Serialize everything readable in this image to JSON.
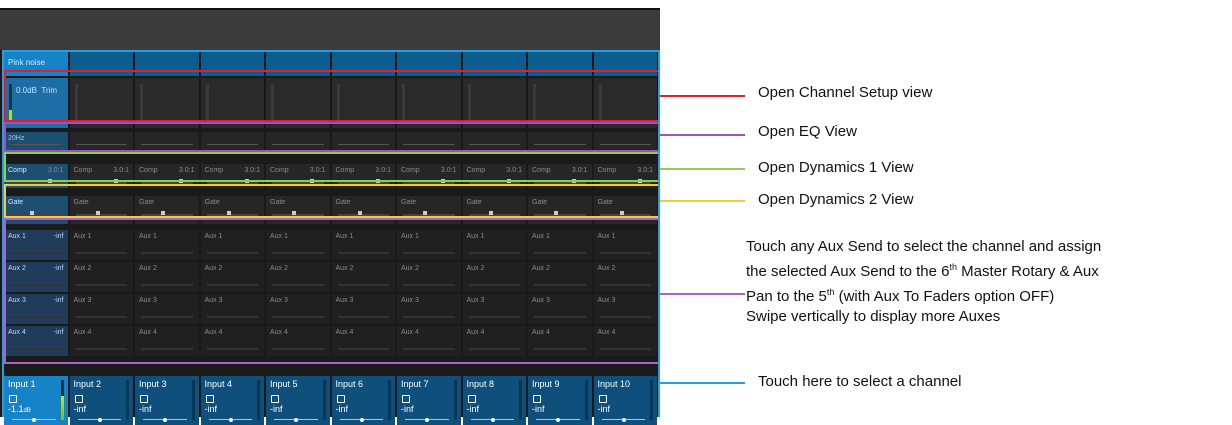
{
  "channels": [
    {
      "header": "Pink noise",
      "trim": "0.0dB",
      "trim_label": "Trim",
      "eq": "20Hz",
      "comp": "Comp",
      "comp_ratio": "3.0:1",
      "gate": "Gate",
      "auxes": [
        "Aux 1",
        "Aux 2",
        "Aux 3",
        "Aux 4"
      ],
      "aux_value": "-inf",
      "name": "Input 1",
      "level": "-1.1",
      "level_unit": "dB"
    },
    {
      "header": "",
      "name": "Input 2",
      "comp": "Comp",
      "comp_ratio": "3.0:1",
      "gate": "Gate",
      "auxes": [
        "Aux 1",
        "Aux 2",
        "Aux 3",
        "Aux 4"
      ],
      "level": "-inf"
    },
    {
      "header": "",
      "name": "Input 3",
      "comp": "Comp",
      "comp_ratio": "3.0:1",
      "gate": "Gate",
      "auxes": [
        "Aux 1",
        "Aux 2",
        "Aux 3",
        "Aux 4"
      ],
      "level": "-inf"
    },
    {
      "header": "",
      "name": "Input 4",
      "comp": "Comp",
      "comp_ratio": "3.0:1",
      "gate": "Gate",
      "auxes": [
        "Aux 1",
        "Aux 2",
        "Aux 3",
        "Aux 4"
      ],
      "level": "-inf"
    },
    {
      "header": "",
      "name": "Input 5",
      "comp": "Comp",
      "comp_ratio": "3.0:1",
      "gate": "Gate",
      "auxes": [
        "Aux 1",
        "Aux 2",
        "Aux 3",
        "Aux 4"
      ],
      "level": "-inf"
    },
    {
      "header": "",
      "name": "Input 6",
      "comp": "Comp",
      "comp_ratio": "3.0:1",
      "gate": "Gate",
      "auxes": [
        "Aux 1",
        "Aux 2",
        "Aux 3",
        "Aux 4"
      ],
      "level": "-inf"
    },
    {
      "header": "",
      "name": "Input 7",
      "comp": "Comp",
      "comp_ratio": "3.0:1",
      "gate": "Gate",
      "auxes": [
        "Aux 1",
        "Aux 2",
        "Aux 3",
        "Aux 4"
      ],
      "level": "-inf"
    },
    {
      "header": "",
      "name": "Input 8",
      "comp": "Comp",
      "comp_ratio": "3.0:1",
      "gate": "Gate",
      "auxes": [
        "Aux 1",
        "Aux 2",
        "Aux 3",
        "Aux 4"
      ],
      "level": "-inf"
    },
    {
      "header": "",
      "name": "Input 9",
      "comp": "Comp",
      "comp_ratio": "3.0:1",
      "gate": "Gate",
      "auxes": [
        "Aux 1",
        "Aux 2",
        "Aux 3",
        "Aux 4"
      ],
      "level": "-inf"
    },
    {
      "header": "",
      "name": "Input 10",
      "comp": "Comp",
      "comp_ratio": "3.0:1",
      "gate": "Gate",
      "auxes": [
        "Aux 1",
        "Aux 2",
        "Aux 3",
        "Aux 4"
      ],
      "level": "-inf"
    }
  ],
  "annotations": {
    "setup": "Open Channel Setup view",
    "eq": "Open EQ View",
    "dyn1": "Open Dynamics 1 View",
    "dyn2": "Open Dynamics 2 View",
    "aux_line1": "Touch any Aux Send to select the channel and assign",
    "aux_line2_a": "the selected Aux Send to the 6",
    "aux_line2_sup1": "th",
    "aux_line2_b": " Master Rotary & Aux",
    "aux_line3_a": "Pan to the 5",
    "aux_line3_sup": "th",
    "aux_line3_b": " (with Aux To Faders option OFF)",
    "aux_line4": "Swipe vertically to display more Auxes",
    "select": "Touch here to select a channel"
  },
  "colors": {
    "setup": "#e0202a",
    "eq": "#a050c0",
    "dyn1": "#8ccf4a",
    "dyn2": "#f2cc3a",
    "aux": "#b060c8",
    "select": "#2a9de0"
  }
}
